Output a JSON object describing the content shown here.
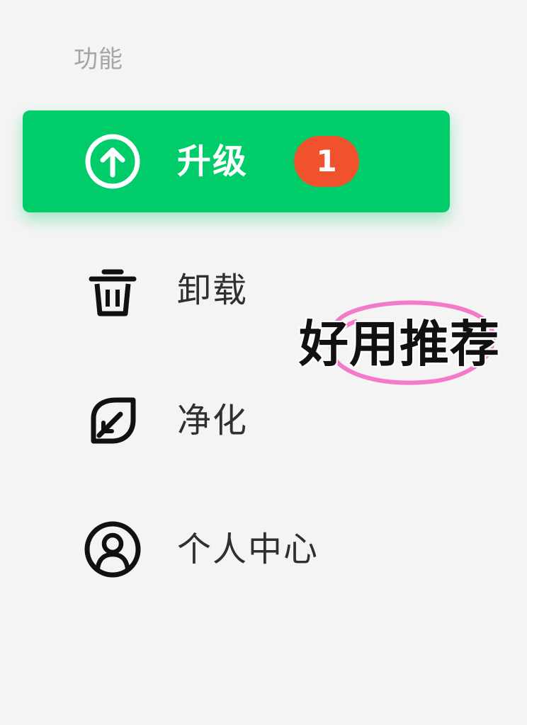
{
  "sidebar": {
    "section_label": "功能",
    "items": [
      {
        "label": "升级",
        "icon": "upgrade-arrow-circle-icon",
        "active": true,
        "badge": "1"
      },
      {
        "label": "卸载",
        "icon": "trash-icon",
        "active": false
      },
      {
        "label": "净化",
        "icon": "leaf-icon",
        "active": false
      },
      {
        "label": "个人中心",
        "icon": "user-circle-icon",
        "active": false
      }
    ]
  },
  "annotation": {
    "text": "好用推荐"
  },
  "colors": {
    "active_background": "#00cc6a",
    "badge_background": "#f0522d",
    "sidebar_background": "#f4f4f4",
    "highlight_circle": "#f27ac8"
  }
}
